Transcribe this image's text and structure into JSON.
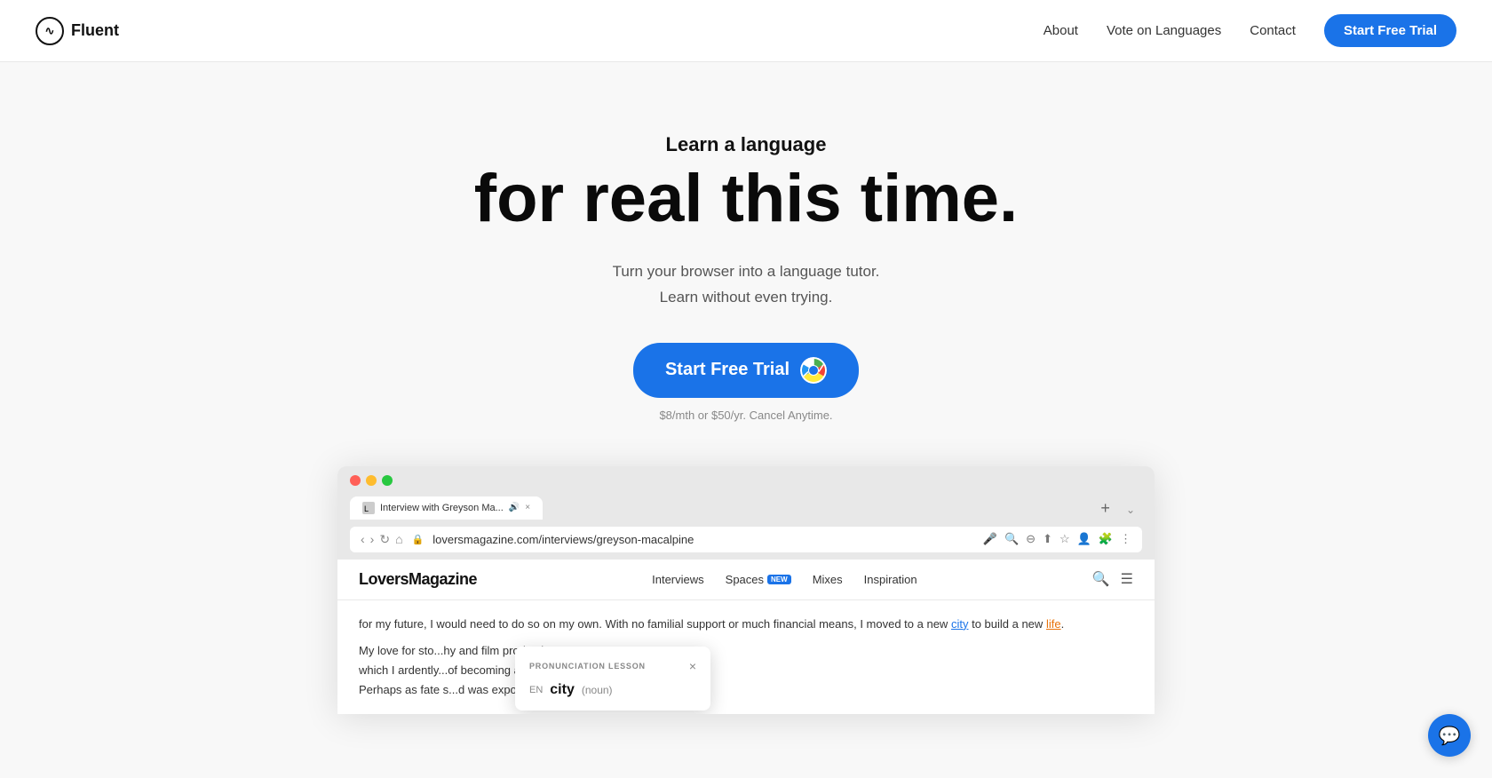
{
  "nav": {
    "logo_text": "Fluent",
    "logo_icon": "∿",
    "links": [
      {
        "label": "About",
        "id": "about"
      },
      {
        "label": "Vote on Languages",
        "id": "vote"
      },
      {
        "label": "Contact",
        "id": "contact"
      }
    ],
    "cta_label": "Start Free Trial"
  },
  "hero": {
    "subtitle": "Learn a language",
    "title": "for real this time.",
    "description_line1": "Turn your browser into a language tutor.",
    "description_line2": "Learn without even trying.",
    "cta_label": "Start Free Trial",
    "price_note": "$8/mth or $50/yr. Cancel Anytime."
  },
  "browser": {
    "tab_title": "Interview with Greyson Ma...",
    "url": "loversmagazine.com/interviews/greyson-macalpine",
    "page_brand": "LoversMagazine",
    "page_nav_links": [
      {
        "label": "Interviews"
      },
      {
        "label": "Spaces",
        "badge": "NEW"
      },
      {
        "label": "Mixes"
      },
      {
        "label": "Inspiration"
      }
    ],
    "body_text_1": "for my future, I would need to do so on my own. With no familial support or much financial means, I moved to a new",
    "highlighted_city": "city",
    "body_text_2": "to build a new",
    "highlighted_life": "life",
    "body_text_3": ".",
    "body_text_4": "My love for sto",
    "body_text_5": "hy and film production,",
    "body_text_6": "which I ardently",
    "body_text_7": "of becoming a director.",
    "body_text_8": "Perhaps as fate s",
    "body_text_9": "d was exposed to the",
    "popup": {
      "label": "PRONUNCIATION LESSON",
      "close": "×",
      "lang": "EN",
      "word": "city",
      "type": "(noun)"
    }
  },
  "chat_icon": "💬"
}
